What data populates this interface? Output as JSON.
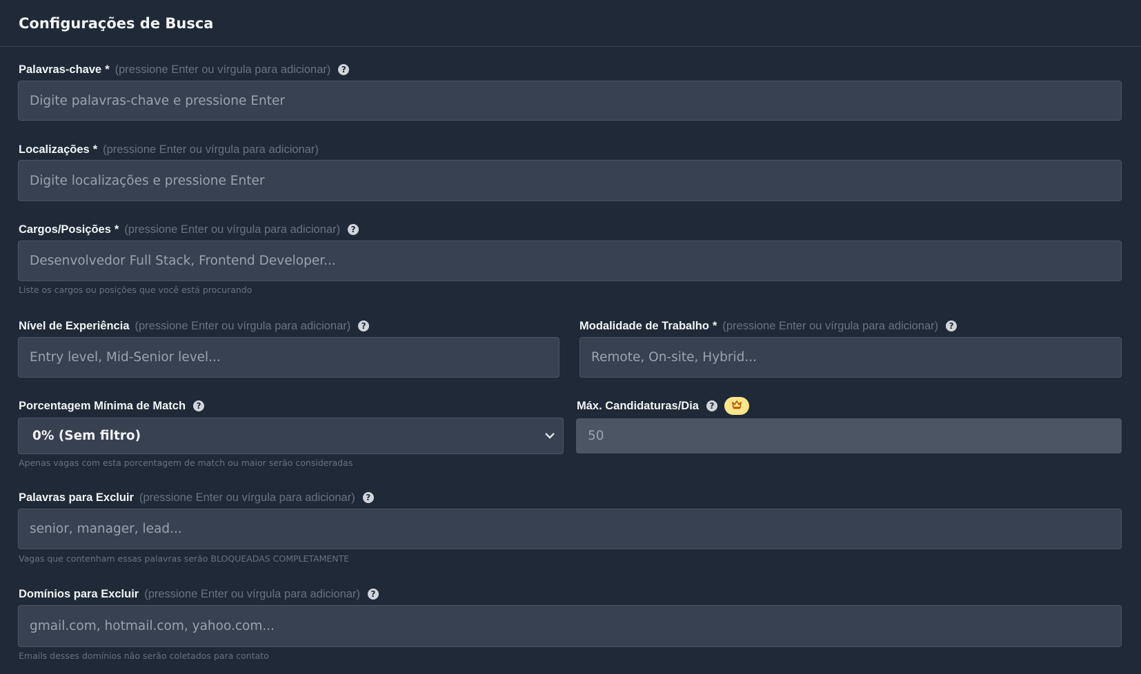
{
  "header": {
    "title": "Configurações de Busca"
  },
  "hint_text": "(pressione Enter ou vírgula para adicionar)",
  "fields": {
    "keywords": {
      "label": "Palavras-chave",
      "required": "*",
      "placeholder": "Digite palavras-chave e pressione Enter"
    },
    "locations": {
      "label": "Localizações",
      "required": "*",
      "placeholder": "Digite localizações e pressione Enter"
    },
    "positions": {
      "label": "Cargos/Posições",
      "required": "*",
      "placeholder": "Desenvolvedor Full Stack, Frontend Developer...",
      "helper": "Liste os cargos ou posições que você está procurando"
    },
    "experience": {
      "label": "Nível de Experiência",
      "placeholder": "Entry level, Mid-Senior level..."
    },
    "work_mode": {
      "label": "Modalidade de Trabalho",
      "required": "*",
      "placeholder": "Remote, On-site, Hybrid..."
    },
    "min_match": {
      "label": "Porcentagem Mínima de Match",
      "value": "0% (Sem filtro)",
      "helper": "Apenas vagas com esta porcentagem de match ou maior serão consideradas"
    },
    "max_apps": {
      "label": "Máx. Candidaturas/Dia",
      "value": "50"
    },
    "exclude_words": {
      "label": "Palavras para Excluir",
      "placeholder": "senior, manager, lead...",
      "helper": "Vagas que contenham essas palavras serão BLOQUEADAS COMPLETAMENTE"
    },
    "exclude_domains": {
      "label": "Domínios para Excluir",
      "placeholder": "gmail.com, hotmail.com, yahoo.com...",
      "helper": "Emails desses domínios não serão coletados para contato"
    }
  },
  "icons": {
    "help": "question-circle-icon",
    "premium": "crown-icon",
    "select": "chevron-down-icon"
  },
  "colors": {
    "background": "#1f2937",
    "input_bg": "#374151",
    "premium_badge": "#fde68a"
  }
}
